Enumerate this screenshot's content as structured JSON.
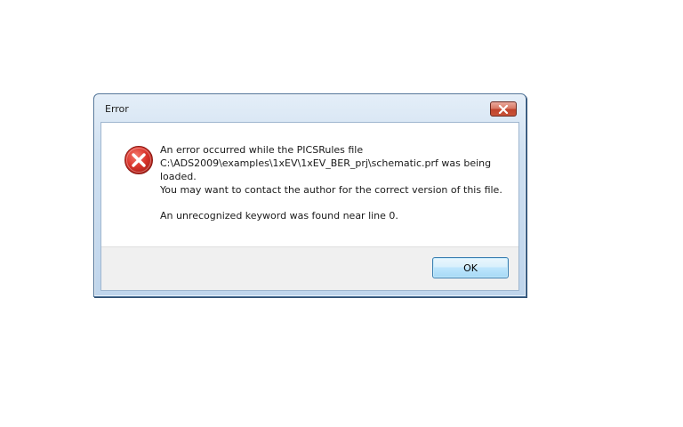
{
  "dialog": {
    "title": "Error",
    "close_label": "",
    "icon": "error-icon",
    "message_lines": [
      "An error occurred while the PICSRules file",
      "C:\\ADS2009\\examples\\1xEV\\1xEV_BER_prj\\schematic.prf was being",
      "loaded.",
      "You may want to contact the author for the correct version of this file."
    ],
    "detail": "An unrecognized keyword was found near line 0.",
    "ok_label": "OK"
  },
  "colors": {
    "frame": "#bfd5ec",
    "close_button": "#c0432b",
    "error_red": "#d32f2f",
    "ok_button_border": "#3c7fb1"
  }
}
